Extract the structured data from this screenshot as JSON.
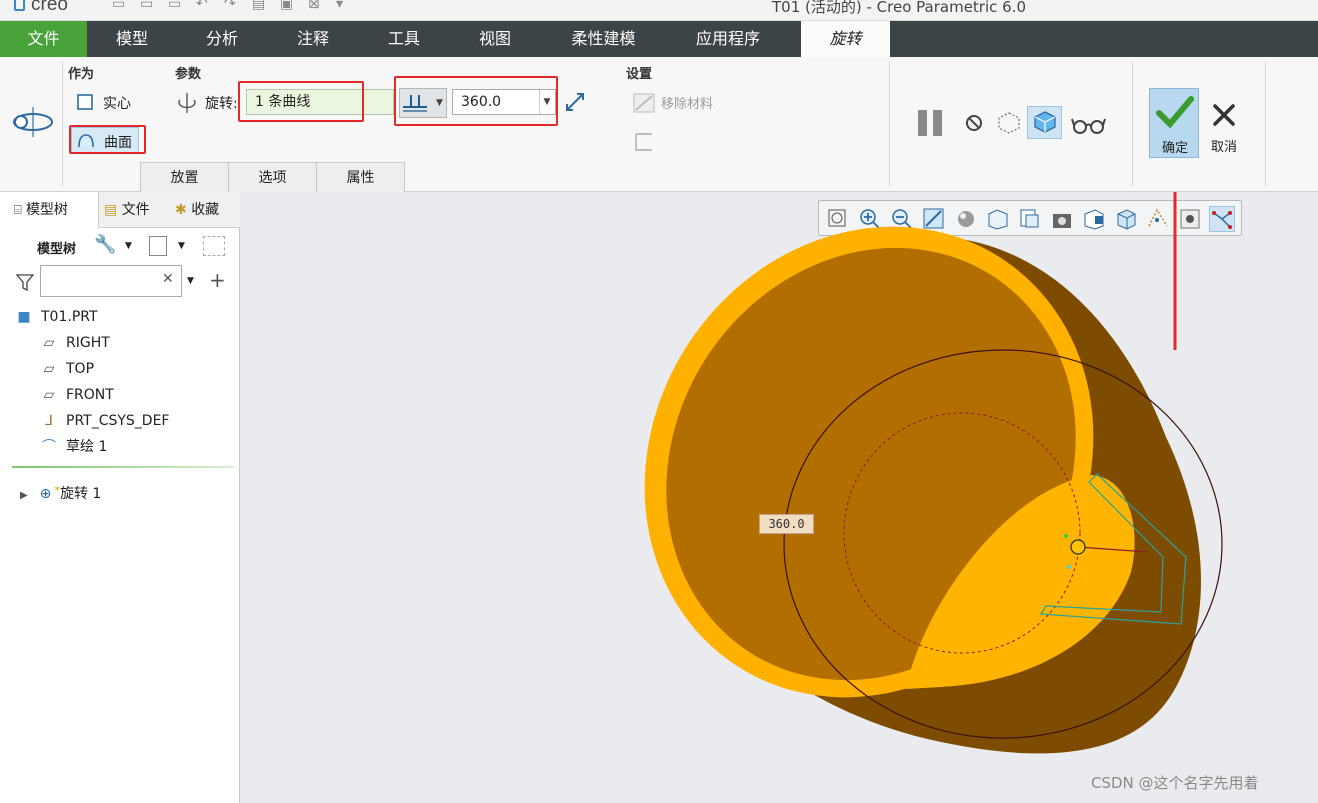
{
  "app": {
    "logo_text": "creo",
    "window_title": "T01 (活动的) - Creo Parametric 6.0"
  },
  "ribbon_tabs": [
    {
      "label": "文件"
    },
    {
      "label": "模型"
    },
    {
      "label": "分析"
    },
    {
      "label": "注释"
    },
    {
      "label": "工具"
    },
    {
      "label": "视图"
    },
    {
      "label": "柔性建模"
    },
    {
      "label": "应用程序"
    },
    {
      "label": "旋转"
    }
  ],
  "dashboard": {
    "as_label": "作为",
    "solid_label": "实心",
    "surface_label": "曲面",
    "params_label": "参数",
    "revolve_label": "旋转:",
    "revolve_value": "1 条曲线",
    "angle_value": "360.0",
    "settings_label": "设置",
    "remove_material_label": "移除材料",
    "ok_label": "确定",
    "cancel_label": "取消",
    "subtabs": [
      {
        "label": "放置"
      },
      {
        "label": "选项"
      },
      {
        "label": "属性"
      }
    ],
    "surface_selected": true,
    "preview_active": true
  },
  "left_panel": {
    "tabs": [
      {
        "label": "模型树"
      },
      {
        "label": "文件"
      },
      {
        "label": "收藏"
      }
    ],
    "header_label": "模型树",
    "filter_placeholder": "",
    "tree": [
      {
        "label": "T01.PRT",
        "icon": "part-icon"
      },
      {
        "label": "RIGHT",
        "icon": "datum-plane-icon"
      },
      {
        "label": "TOP",
        "icon": "datum-plane-icon"
      },
      {
        "label": "FRONT",
        "icon": "datum-plane-icon"
      },
      {
        "label": "PRT_CSYS_DEF",
        "icon": "csys-icon"
      },
      {
        "label": "草绘 1",
        "icon": "sketch-icon"
      },
      {
        "label": "旋转 1",
        "icon": "revolve-icon",
        "marker": "*"
      }
    ]
  },
  "viewport": {
    "dimension_tag": "360.0",
    "watermark": "CSDN @这个名字先用着",
    "colors": {
      "shell_outer": "#a86400",
      "shell_rim": "#ffb100",
      "interior": "#b06f00",
      "highlight": "#ffb400"
    }
  }
}
